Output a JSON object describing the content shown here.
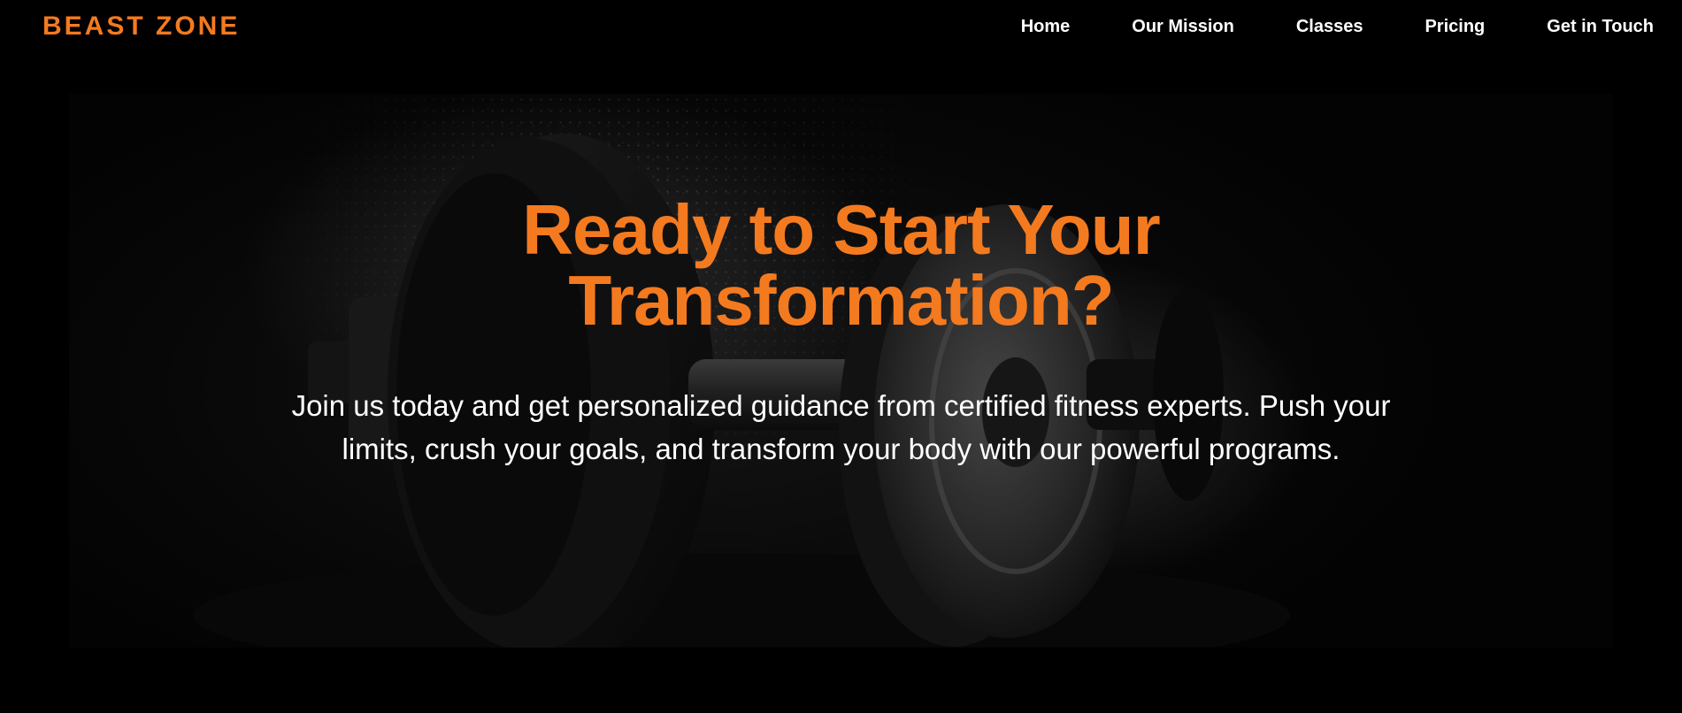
{
  "brand": {
    "name": "BEAST ZONE",
    "accent_color": "#f47a1f"
  },
  "nav": {
    "items": [
      {
        "label": "Home"
      },
      {
        "label": "Our Mission"
      },
      {
        "label": "Classes"
      },
      {
        "label": "Pricing"
      },
      {
        "label": "Get in Touch"
      }
    ]
  },
  "hero": {
    "headline_line1": "Ready to Start Your",
    "headline_line2": "Transformation?",
    "subtext": "Join us today and get personalized guidance from certified fitness experts. Push your limits, crush your goals, and transform your body with our powerful programs.",
    "background_image": "dumbbell-photo"
  }
}
